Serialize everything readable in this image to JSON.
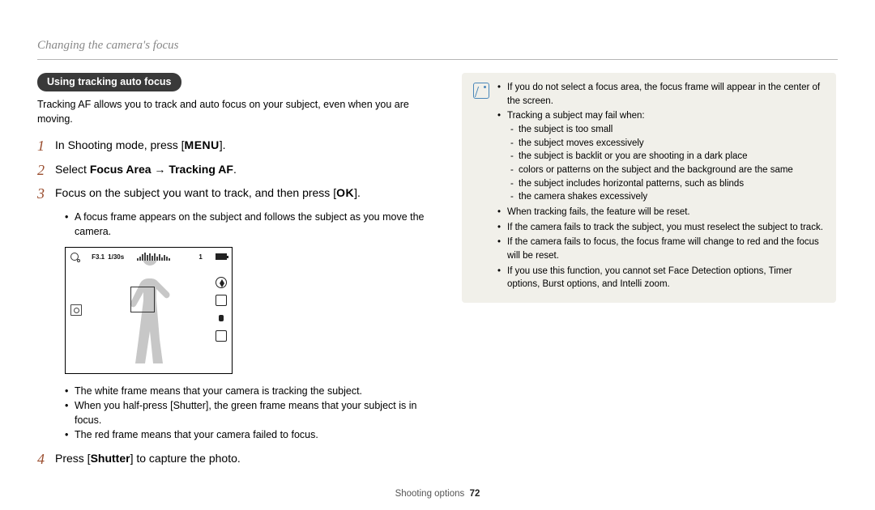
{
  "header": {
    "title": "Changing the camera's focus"
  },
  "section": {
    "pill": "Using tracking auto focus",
    "intro": "Tracking AF allows you to track and auto focus on your subject, even when you are moving."
  },
  "steps": {
    "s1_a": "In Shooting mode, press [",
    "s1_btn": "MENU",
    "s1_b": "].",
    "s2_a": "Select ",
    "s2_b1": "Focus Area",
    "s2_arrow": " → ",
    "s2_b2": "Tracking AF",
    "s2_c": ".",
    "s3_a": "Focus on the subject you want to track, and then press [",
    "s3_btn": "OK",
    "s3_b": "].",
    "s3_sub": "A focus frame appears on the subject and follows the subject as you move the camera.",
    "after_white": "The white frame means that your camera is tracking the subject.",
    "after_half_a": "When you half-press [",
    "after_half_b": "Shutter",
    "after_half_c": "], the green frame means that your subject is in focus.",
    "after_red": "The red frame means that your camera failed to focus.",
    "s4_a": "Press [",
    "s4_b": "Shutter",
    "s4_c": "] to capture the photo."
  },
  "lcd": {
    "fnum": "F3.1",
    "shutter": "1/30s",
    "count": "1"
  },
  "notes": {
    "n1": "If you do not select a focus area, the focus frame will appear in the center of the screen.",
    "n2": "Tracking a subject may fail when:",
    "d1": "the subject is too small",
    "d2": "the subject moves excessively",
    "d3": "the subject is backlit or you are shooting in a dark place",
    "d4": "colors or patterns on the subject and the background are the same",
    "d5": "the subject includes horizontal patterns, such as blinds",
    "d6": "the camera shakes excessively",
    "n3": "When tracking fails, the feature will be reset.",
    "n4": "If the camera fails to track the subject, you must reselect the subject to track.",
    "n5": "If the camera fails to focus, the focus frame will change to red and the focus will be reset.",
    "n6": "If you use this function, you cannot set Face Detection options, Timer options, Burst options, and Intelli zoom."
  },
  "footer": {
    "section": "Shooting options",
    "page": "72"
  }
}
